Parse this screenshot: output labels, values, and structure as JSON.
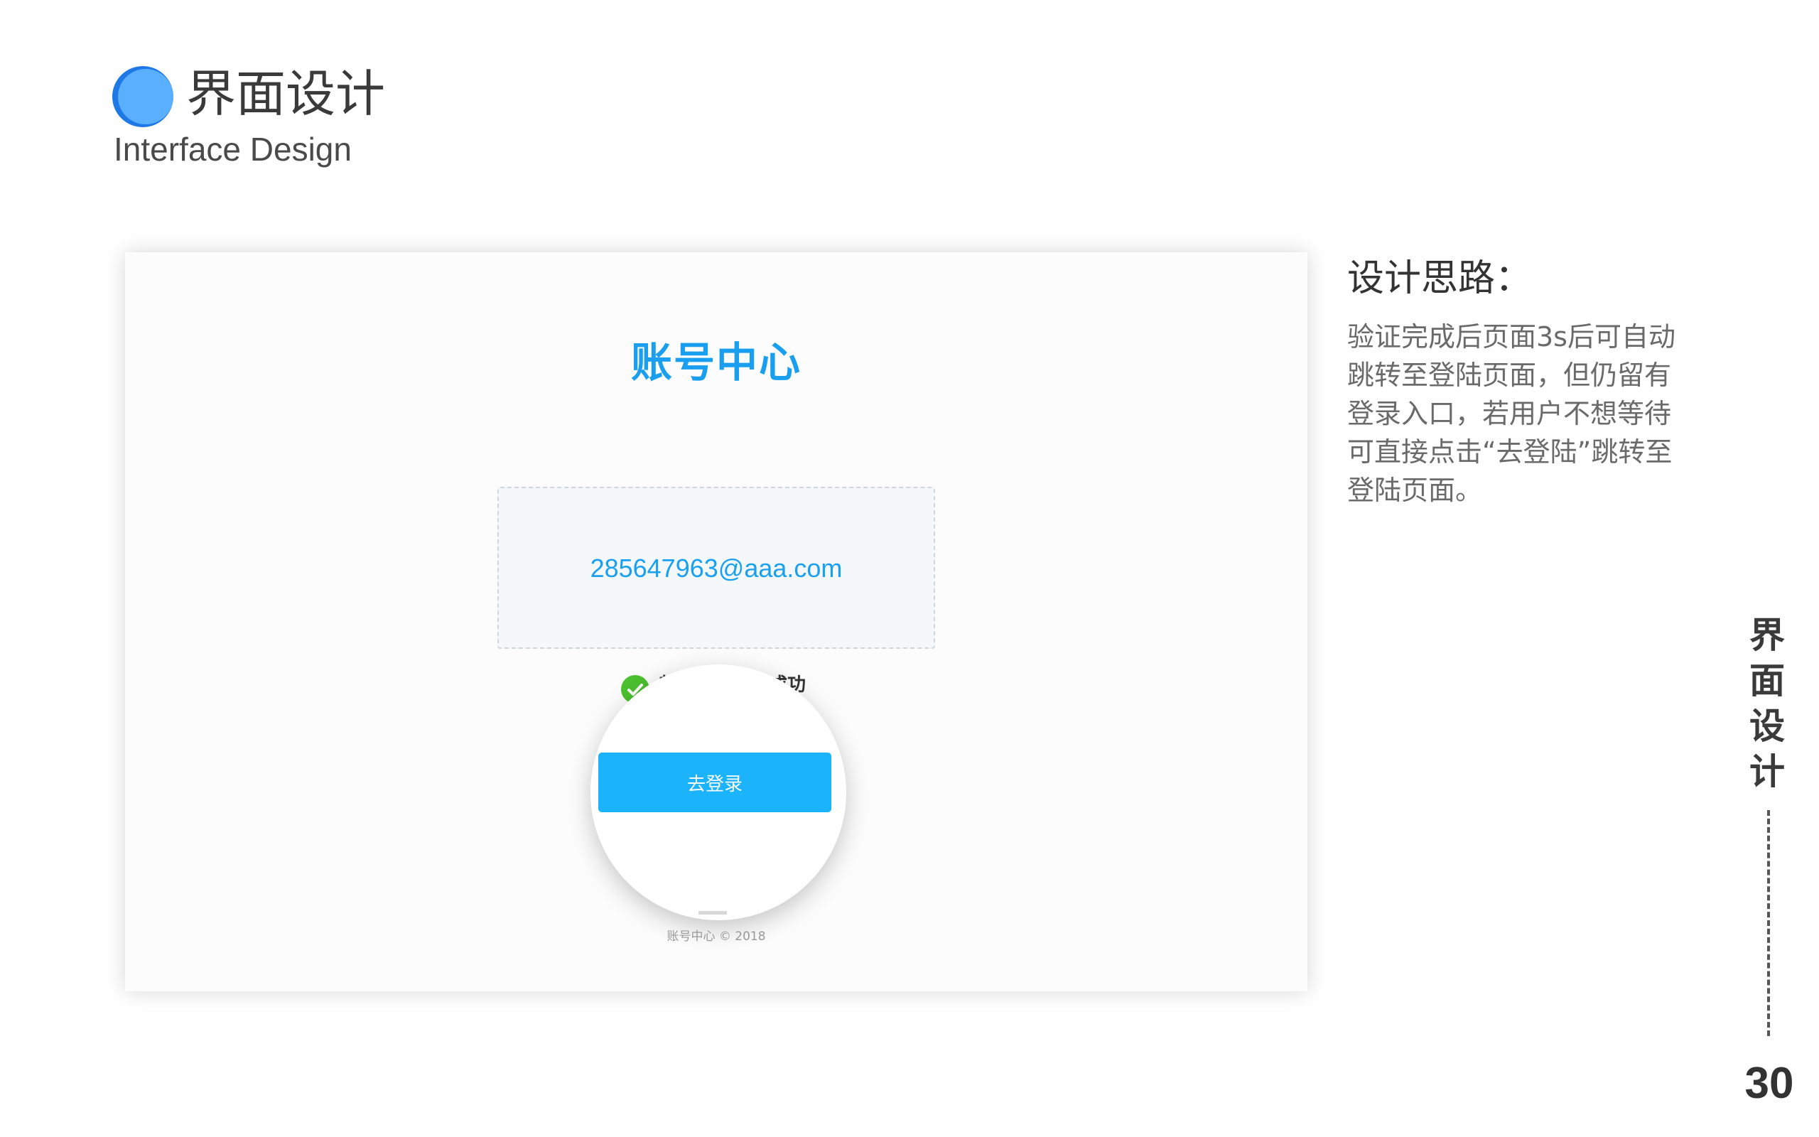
{
  "header": {
    "title": "界面设计",
    "subtitle": "Interface Design"
  },
  "mockup": {
    "app_logo": "账号中心",
    "email": "285647963@aaa.com",
    "success_message": "恭喜你，注册成功",
    "login_button": "去登录",
    "footer": "账号中心 © 2018"
  },
  "description": {
    "heading": "设计思路：",
    "lines": [
      "验证完成后页面3s后可自动",
      "跳转至登陆页面，但仍留有",
      "登录入口，若用户不想等待",
      "可直接点击“去登陆”跳转至",
      "登陆页面。"
    ]
  },
  "side_label": "界面设计",
  "page_number": "30",
  "colors": {
    "accent": "#1a9ff0",
    "button": "#1ab3fc",
    "success": "#4cc12f",
    "logo_circle": "#5ab0ff"
  },
  "icons": {
    "logo": "blue-circle-icon",
    "success": "check-circle-icon"
  }
}
